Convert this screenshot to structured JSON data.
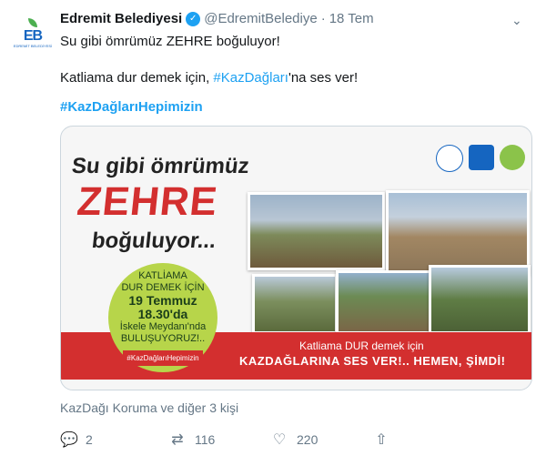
{
  "tweet": {
    "display_name": "Edremit Belediyesi",
    "verified_glyph": "✓",
    "handle": "@EdremitBelediye",
    "separator": "·",
    "date": "18 Tem",
    "text_line1": "Su gibi ömrümüz ZEHRE boğuluyor!",
    "text_line2_pre": "Katliama dur demek için, ",
    "text_line2_link": "#KazDağları",
    "text_line2_post": "'na ses ver!",
    "hashtag": "#KazDağlarıHepimizin",
    "liked_by": "KazDağı Koruma ve diğer 3 kişi"
  },
  "avatar": {
    "letters": "EB",
    "sub": "EDREMİT BELEDİYESİ"
  },
  "card": {
    "headline1": "Su gibi ömrümüz",
    "headline2": "ZEHRE",
    "headline3": "boğuluyor...",
    "circle_line1": "KATLİAMA",
    "circle_line2": "DUR DEMEK İÇİN",
    "circle_line3": "19 Temmuz",
    "circle_line4": "18.30'da",
    "circle_line5": "İskele Meydanı'nda",
    "circle_line6": "BULUŞUYORUZ!..",
    "circle_tag": "#KazDağlarıHepimizin",
    "banner_line1": "Katliama DUR demek için",
    "banner_line2": "KAZDAĞLARINA SES VER!.. HEMEN, ŞİMDİ!"
  },
  "actions": {
    "replies": "2",
    "retweets": "116",
    "likes": "220"
  },
  "icons": {
    "reply": "reply-icon",
    "retweet": "retweet-icon",
    "like": "heart-icon",
    "share": "share-icon",
    "caret": "chevron-down-icon"
  },
  "colors": {
    "link": "#1da1f2",
    "muted": "#657786",
    "brand_red": "#d32f2f"
  }
}
